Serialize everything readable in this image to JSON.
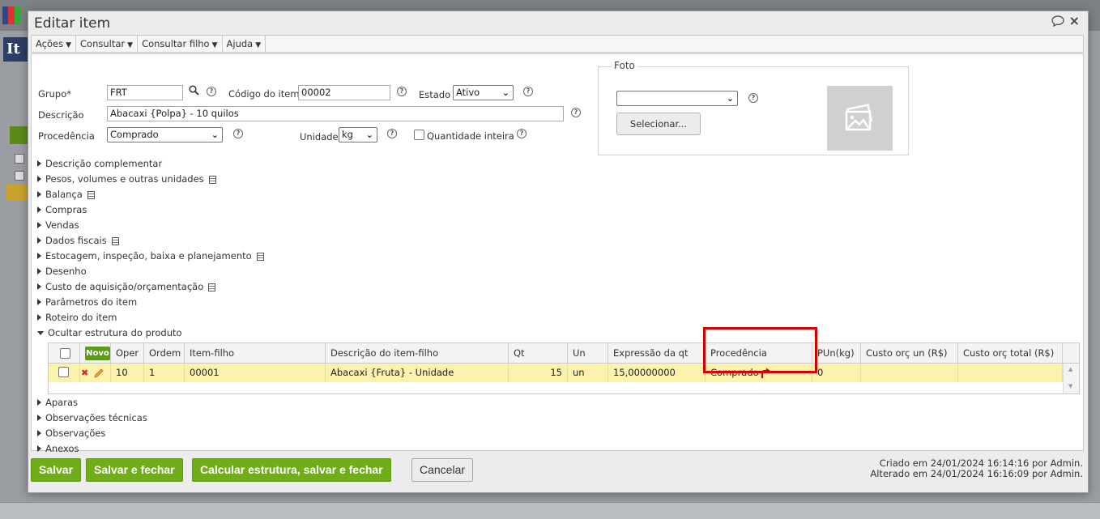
{
  "modal": {
    "title": "Editar item",
    "icons": {
      "comment": "comment-icon",
      "close": "×"
    }
  },
  "menubar": [
    {
      "label": "Ações"
    },
    {
      "label": "Consultar"
    },
    {
      "label": "Consultar filho"
    },
    {
      "label": "Ajuda"
    }
  ],
  "form": {
    "grupo_label": "Grupo*",
    "grupo_value": "FRT",
    "codigo_label": "Código do item",
    "codigo_value": "00002",
    "estado_label": "Estado",
    "estado_value": "Ativo",
    "descricao_label": "Descrição",
    "descricao_value": "Abacaxi {Polpa} - 10 quilos",
    "procedencia_label": "Procedência",
    "procedencia_value": "Comprado",
    "unidade_label": "Unidade",
    "unidade_value": "kg",
    "quantidade_inteira_label": "Quantidade inteira",
    "help_glyph": "?"
  },
  "foto": {
    "legend": "Foto",
    "select_value": "",
    "button_label": "Selecionar..."
  },
  "sections": [
    {
      "label": "Descrição complementar",
      "has_doc": false
    },
    {
      "label": "Pesos, volumes e outras unidades",
      "has_doc": true
    },
    {
      "label": "Balança",
      "has_doc": true
    },
    {
      "label": "Compras",
      "has_doc": false
    },
    {
      "label": "Vendas",
      "has_doc": false
    },
    {
      "label": "Dados fiscais",
      "has_doc": true
    },
    {
      "label": "Estocagem, inspeção, baixa e planejamento",
      "has_doc": true
    },
    {
      "label": "Desenho",
      "has_doc": false
    },
    {
      "label": "Custo de aquisição/orçamentação",
      "has_doc": true
    },
    {
      "label": "Parâmetros do item",
      "has_doc": false
    },
    {
      "label": "Roteiro do item",
      "has_doc": false
    },
    {
      "label": "Ocultar estrutura do produto",
      "has_doc": false,
      "expanded": true
    }
  ],
  "sections_after": [
    {
      "label": "Aparas"
    },
    {
      "label": "Observações técnicas"
    },
    {
      "label": "Observações"
    },
    {
      "label": "Anexos"
    }
  ],
  "grid": {
    "novo_label": "Novo",
    "columns": [
      "Oper",
      "Ordem",
      "Item-filho",
      "Descrição do item-filho",
      "Qt",
      "Un",
      "Expressão da qt",
      "Procedência",
      "PUn(kg)",
      "Custo orç un (R$)",
      "Custo orç total (R$)"
    ],
    "rows": [
      {
        "oper": "10",
        "ordem": "1",
        "item_filho": "00001",
        "descricao": "Abacaxi {Fruta} - Unidade",
        "qt": "15",
        "un": "un",
        "expressao": "15,00000000",
        "procedencia": "Comprado",
        "pun": "0",
        "custo_un": "",
        "custo_total": ""
      }
    ]
  },
  "footer": {
    "salvar": "Salvar",
    "salvar_fechar": "Salvar e fechar",
    "calcular": "Calcular estrutura, salvar e fechar",
    "cancelar": "Cancelar",
    "criado": "Criado em 24/01/2024 16:14:16 por Admin.",
    "alterado": "Alterado em 24/01/2024 16:16:09 por Admin."
  },
  "background": {
    "app_title_fragment": "It"
  },
  "colors": {
    "accent_green": "#6fae18",
    "highlight_row": "#fbf2ae",
    "highlight_border": "#d40000",
    "arrow_red": "#d40000"
  }
}
